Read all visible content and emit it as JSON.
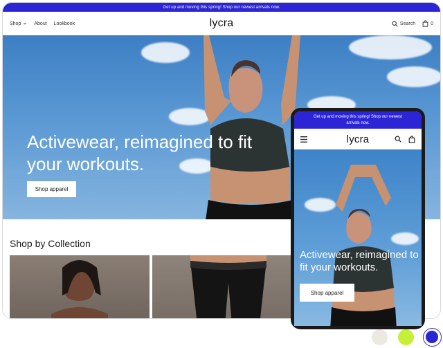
{
  "announcement": "Get up and moving this spring! Shop our newest arrivals now.",
  "header": {
    "nav": [
      {
        "label": "Shop",
        "has_dropdown": true
      },
      {
        "label": "About"
      },
      {
        "label": "Lookbook"
      }
    ],
    "logo": "lycra",
    "search_label": "Search",
    "cart_count": "0"
  },
  "hero": {
    "headline": "Activewear, reimagined to fit your workouts.",
    "cta_label": "Shop apparel"
  },
  "collection": {
    "title": "Shop by Collection"
  },
  "mobile": {
    "announcement": "Get up and moving this spring! Shop our newest arrivals now.",
    "logo": "lycra",
    "headline": "Activewear, reimagined to fit your workouts.",
    "cta_label": "Shop apparel"
  },
  "swatches": [
    {
      "color": "#ece8e2"
    },
    {
      "color": "#c6ef3a"
    },
    {
      "color": "#2c25d6",
      "selected": true
    }
  ],
  "icons": [
    "chevron-down-icon",
    "search-icon",
    "cart-icon",
    "menu-icon"
  ],
  "colors": {
    "brand_blue": "#2c25d6",
    "lime": "#c6ef3a"
  }
}
